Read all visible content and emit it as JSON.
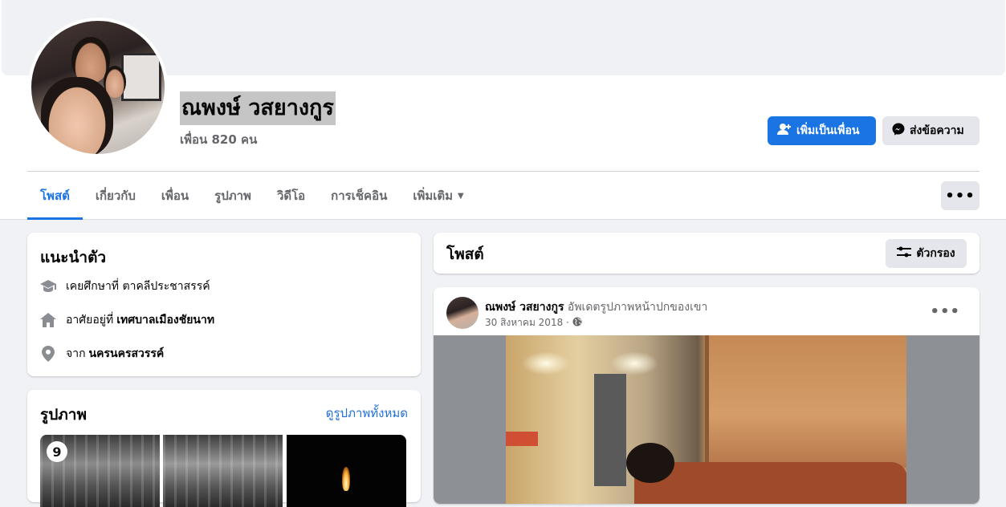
{
  "profile": {
    "name": "ณพงษ์ วสยางกูร",
    "friends_text": "เพื่อน 820 คน"
  },
  "actions": {
    "add_friend": "เพิ่มเป็นเพื่อน",
    "message": "ส่งข้อความ",
    "more": "•••"
  },
  "tabs": [
    {
      "label": "โพสต์",
      "active": true
    },
    {
      "label": "เกี่ยวกับ"
    },
    {
      "label": "เพื่อน"
    },
    {
      "label": "รูปภาพ"
    },
    {
      "label": "วิดีโอ"
    },
    {
      "label": "การเช็คอิน"
    },
    {
      "label": "เพิ่มเติม"
    }
  ],
  "intro": {
    "title": "แนะนำตัว",
    "studied_prefix": "เคยศึกษาที่ ตาคลีประชาสรรค์",
    "lives_prefix": "อาศัยอยู่ที่",
    "lives_place": "เทศบาลเมืองชัยนาท",
    "from_prefix": "จาก",
    "from_place": "นครนครสวรรค์"
  },
  "photos": {
    "title": "รูปภาพ",
    "see_all": "ดูรูปภาพทั้งหมด",
    "badge": "9"
  },
  "posts": {
    "title": "โพสต์",
    "filter": "ตัวกรอง"
  },
  "post": {
    "author": "ณพงษ์ วสยางกูร",
    "action": "อัพเดตรูปภาพหน้าปกของเขา",
    "date": "30 สิงหาคม 2018 ·",
    "menu": "•••"
  },
  "colors": {
    "accent": "#1b74e4",
    "link": "#216fdb",
    "secondary_text": "#65676b",
    "button_gray": "#e4e6eb",
    "page_bg": "#f0f2f5"
  }
}
